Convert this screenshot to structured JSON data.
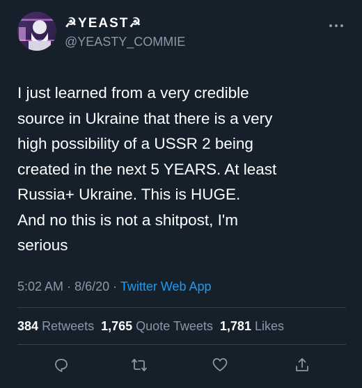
{
  "author": {
    "display_name": "☭YEAST☭",
    "handle": "@YEASTY_COMMIE",
    "avatar_icon": "avatar-image"
  },
  "tweet": {
    "text_lines": [
      "I just learned from a very credible",
      "source in Ukraine that there is a very",
      "high possibility of a USSR 2 being",
      "created in the next 5 YEARS. At least",
      "Russia+ Ukraine. This is HUGE.",
      "And no this is not a shitpost, I'm",
      "serious"
    ],
    "time": "5:02 AM",
    "date": "8/6/20",
    "separator": "·",
    "source": "Twitter Web App"
  },
  "stats": {
    "retweets_count": "384",
    "retweets_label": "Retweets",
    "quotes_count": "1,765",
    "quotes_label": "Quote Tweets",
    "likes_count": "1,781",
    "likes_label": "Likes"
  },
  "actions": {
    "reply_icon": "reply-icon",
    "retweet_icon": "retweet-icon",
    "like_icon": "heart-icon",
    "share_icon": "share-icon"
  },
  "colors": {
    "background": "#15202b",
    "text_primary": "#ffffff",
    "text_secondary": "#8b98a5",
    "accent": "#1d9bf0",
    "divider": "#38444d"
  }
}
